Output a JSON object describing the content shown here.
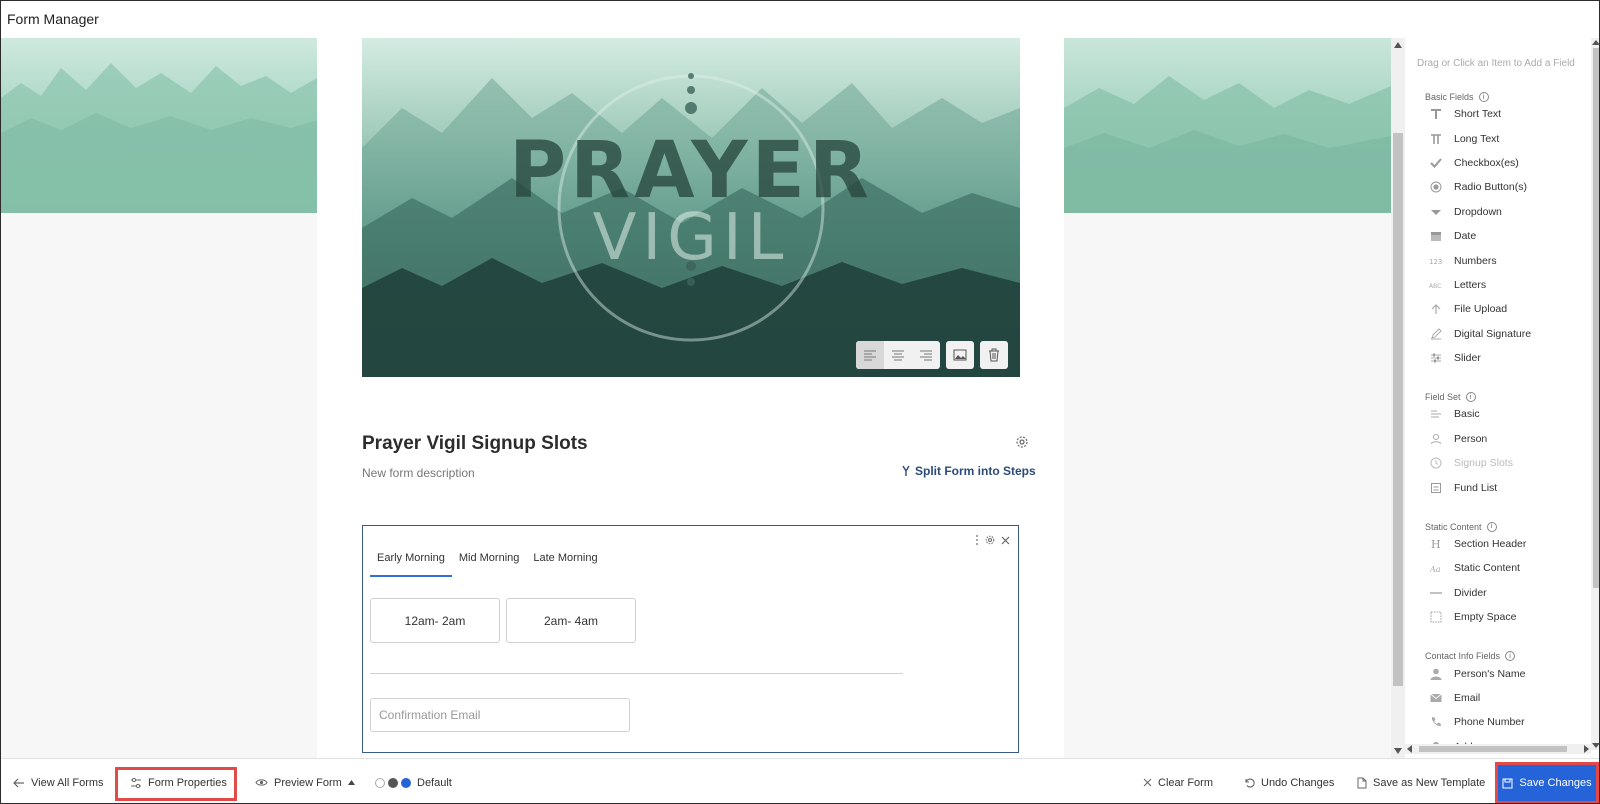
{
  "app": {
    "title": "Form Manager"
  },
  "hero": {
    "title": "PRAYER",
    "subtitle": "VIGIL"
  },
  "form": {
    "title": "Prayer Vigil Signup Slots",
    "description": "New form description",
    "split_label": "Split Form into Steps"
  },
  "slots": {
    "tabs": [
      {
        "label": "Early Morning",
        "active": true
      },
      {
        "label": "Mid Morning",
        "active": false
      },
      {
        "label": "Late Morning",
        "active": false
      }
    ],
    "times": [
      "12am- 2am",
      "2am- 4am"
    ],
    "email_placeholder": "Confirmation Email"
  },
  "palette": {
    "hint": "Drag or Click an Item to Add a Field",
    "sections": [
      {
        "title": "Basic Fields",
        "items": [
          {
            "label": "Short Text",
            "icon": "text-icon"
          },
          {
            "label": "Long Text",
            "icon": "paragraph-icon"
          },
          {
            "label": "Checkbox(es)",
            "icon": "check-icon"
          },
          {
            "label": "Radio Button(s)",
            "icon": "radio-icon"
          },
          {
            "label": "Dropdown",
            "icon": "caret-down-icon"
          },
          {
            "label": "Date",
            "icon": "calendar-icon"
          },
          {
            "label": "Numbers",
            "icon": "numbers-icon"
          },
          {
            "label": "Letters",
            "icon": "letters-icon"
          },
          {
            "label": "File Upload",
            "icon": "upload-icon"
          },
          {
            "label": "Digital Signature",
            "icon": "pen-icon"
          },
          {
            "label": "Slider",
            "icon": "slider-icon"
          }
        ]
      },
      {
        "title": "Field Set",
        "items": [
          {
            "label": "Basic",
            "icon": "lines-icon"
          },
          {
            "label": "Person",
            "icon": "person-outline-icon"
          },
          {
            "label": "Signup Slots",
            "icon": "clock-icon",
            "disabled": true
          },
          {
            "label": "Fund List",
            "icon": "fund-icon"
          }
        ]
      },
      {
        "title": "Static Content",
        "items": [
          {
            "label": "Section Header",
            "icon": "header-icon"
          },
          {
            "label": "Static Content",
            "icon": "static-text-icon"
          },
          {
            "label": "Divider",
            "icon": "divider-icon"
          },
          {
            "label": "Empty Space",
            "icon": "dashed-box-icon"
          }
        ]
      },
      {
        "title": "Contact Info Fields",
        "items": [
          {
            "label": "Person's Name",
            "icon": "person-icon"
          },
          {
            "label": "Email",
            "icon": "envelope-icon"
          },
          {
            "label": "Phone Number",
            "icon": "phone-icon"
          },
          {
            "label": "Address",
            "icon": "map-pin-icon"
          }
        ]
      }
    ]
  },
  "bottombar": {
    "view_all": "View All Forms",
    "form_properties": "Form Properties",
    "preview": "Preview Form",
    "theme": "Default",
    "clear": "Clear Form",
    "undo": "Undo Changes",
    "save_template": "Save as New Template",
    "save": "Save Changes"
  },
  "colors": {
    "accent": "#2563d9",
    "highlight": "#e24a4a",
    "box_border": "#3a5a8c",
    "tab_active": "#2f6fd6"
  }
}
